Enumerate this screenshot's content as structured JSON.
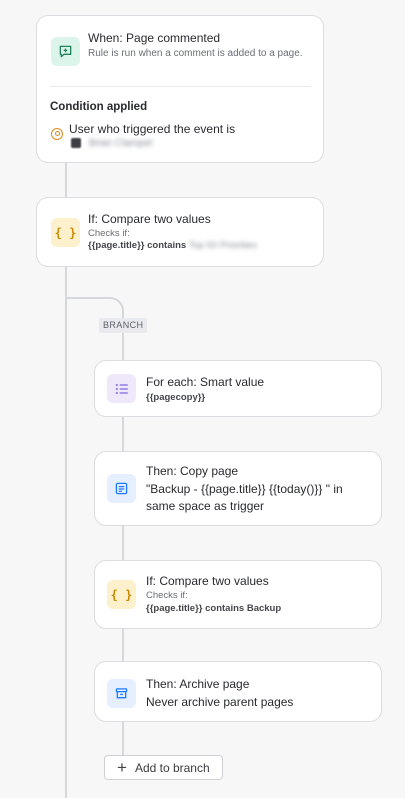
{
  "trigger": {
    "title": "When: Page commented",
    "description": "Rule is run when a comment is added to a page.",
    "condition_heading": "Condition applied",
    "condition_text": "User who triggered the event is",
    "condition_value": "Brian Clampet",
    "icon": "comment-plus-icon"
  },
  "condition1": {
    "title": "If: Compare two values",
    "checks_label": "Checks if:",
    "expr_var": "{{page.title}}",
    "expr_op": "contains",
    "expr_value": "Top 50 Priorities",
    "icon": "braces-icon"
  },
  "branch": {
    "tag": "BRANCH",
    "foreach": {
      "title": "For each: Smart value",
      "value": "{{pagecopy}}",
      "icon": "list-icon"
    },
    "copy_page": {
      "title": "Then: Copy page",
      "line1": "\"Backup - {{page.title}} {{today()}} \" in",
      "line2": "same space as trigger",
      "icon": "page-icon"
    },
    "condition2": {
      "title": "If: Compare two values",
      "checks_label": "Checks if:",
      "expr": "{{page.title}} contains Backup",
      "icon": "braces-icon"
    },
    "archive": {
      "title": "Then: Archive page",
      "description": "Never archive parent pages",
      "icon": "archive-icon"
    },
    "add_button": "Add to branch"
  },
  "colors": {
    "connector": "#d6d7db",
    "accent_green": "#1f845a",
    "accent_yellow": "#c98a06",
    "accent_purple": "#8f7ee7",
    "accent_blue": "#1d7afc"
  }
}
